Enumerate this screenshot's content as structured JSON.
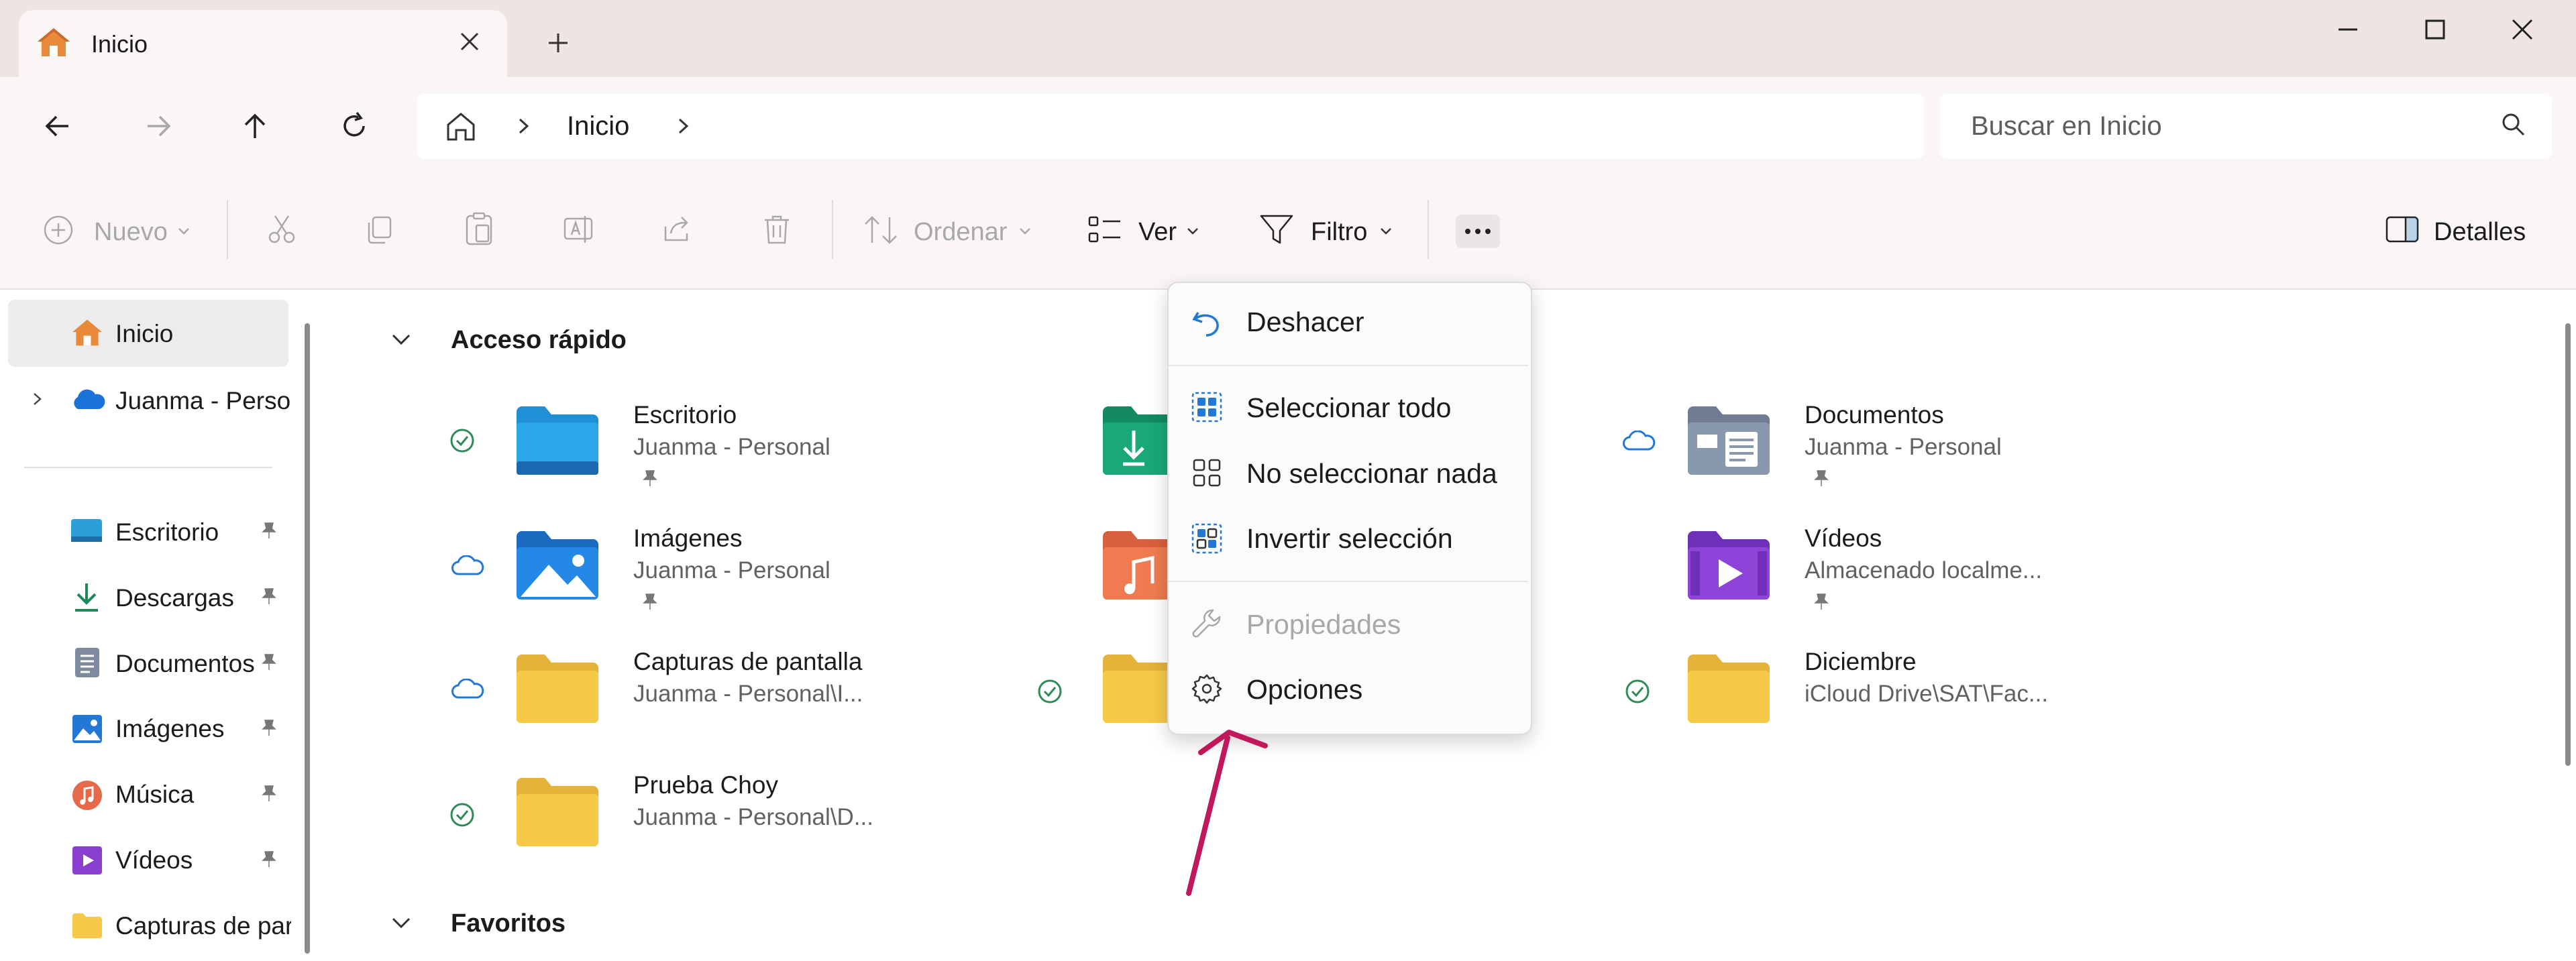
{
  "tab": {
    "title": "Inicio",
    "close_icon": "close-icon",
    "new_tab_icon": "plus-icon"
  },
  "window": {
    "minimize": "minimize-icon",
    "maximize": "maximize-icon",
    "close": "close-icon"
  },
  "address": {
    "location": "Inicio"
  },
  "search": {
    "placeholder": "Buscar en Inicio"
  },
  "toolbar": {
    "new_label": "Nuevo",
    "sort_label": "Ordenar",
    "view_label": "Ver",
    "filter_label": "Filtro",
    "details_label": "Detalles"
  },
  "sidebar": {
    "top": [
      {
        "label": "Inicio"
      },
      {
        "label": "Juanma - Persor"
      }
    ],
    "pinned": [
      {
        "label": "Escritorio"
      },
      {
        "label": "Descargas"
      },
      {
        "label": "Documentos"
      },
      {
        "label": "Imágenes"
      },
      {
        "label": "Música"
      },
      {
        "label": "Vídeos"
      },
      {
        "label": "Capturas de par"
      }
    ]
  },
  "main": {
    "quick_access": "Acceso rápido",
    "favorites": "Favoritos",
    "items": [
      {
        "name": "Escritorio",
        "sub": "Juanma - Personal"
      },
      {
        "name": "Documentos",
        "sub": "Juanma - Personal"
      },
      {
        "name": "Imágenes",
        "sub": "Juanma - Personal"
      },
      {
        "name": "Vídeos",
        "sub": "Almacenado localme..."
      },
      {
        "name": "Capturas de pantalla",
        "sub": "Juanma - Personal\\I..."
      },
      {
        "name": "Diciembre",
        "sub": "iCloud Drive\\SAT\\Fac..."
      },
      {
        "name": "Prueba Choy",
        "sub": "Juanma - Personal\\D..."
      }
    ]
  },
  "menu": {
    "undo": "Deshacer",
    "select_all": "Seleccionar todo",
    "select_none": "No seleccionar nada",
    "invert": "Invertir selección",
    "properties": "Propiedades",
    "options": "Opciones"
  },
  "colors": {
    "accent": "#0067c0",
    "arrow": "#c2185b",
    "folder": "#f7c948",
    "synced": "#2e8b57",
    "titlebar": "#efe4e4"
  }
}
